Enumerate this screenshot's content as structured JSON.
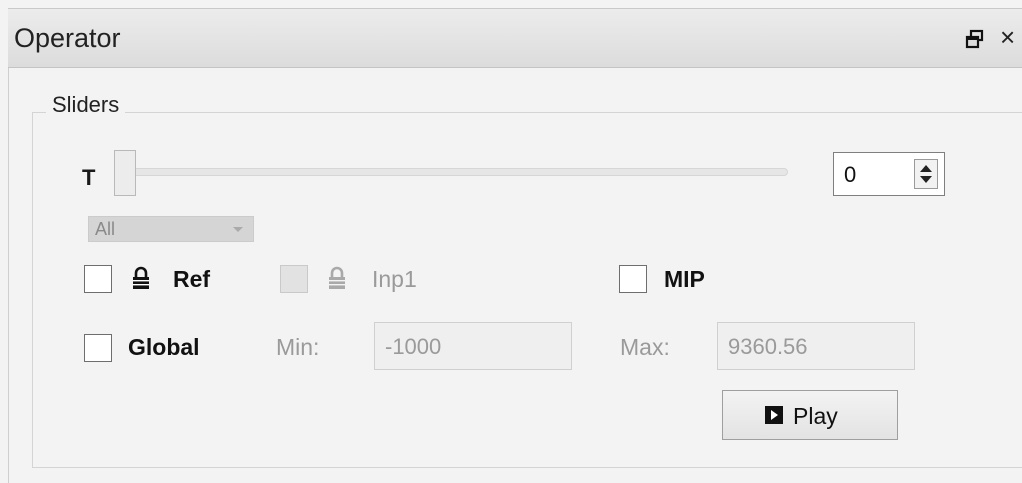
{
  "window": {
    "title": "Operator",
    "float_icon": "float-icon",
    "close_glyph": "×"
  },
  "sliders_group": {
    "title": "Sliders",
    "slider": {
      "label": "T",
      "value": 0,
      "min_level": 0
    },
    "spinbox": {
      "value": "0"
    },
    "combo": {
      "selected": "All"
    },
    "checkboxes": {
      "ref": {
        "label": "Ref",
        "checked": false,
        "icon": "lock-icon"
      },
      "inp1": {
        "label": "Inp1",
        "checked": false,
        "disabled": true,
        "icon": "lock-icon"
      },
      "mip": {
        "label": "MIP",
        "checked": false
      },
      "global": {
        "label": "Global",
        "checked": false
      }
    },
    "range": {
      "min_label": "Min:",
      "min_value": "-1000",
      "max_label": "Max:",
      "max_value": "9360.56"
    },
    "play_button": {
      "label": "Play",
      "icon": "play-icon"
    }
  }
}
